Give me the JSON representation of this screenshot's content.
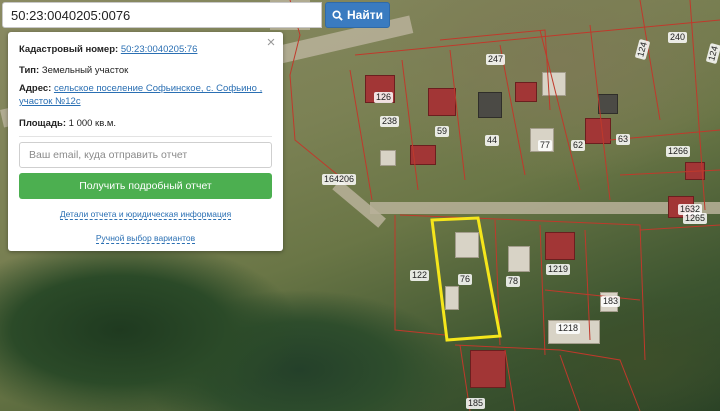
{
  "search": {
    "value": "50:23:0040205:0076",
    "button_label": "Найти"
  },
  "card": {
    "cadastral_label": "Кадастровый номер:",
    "cadastral_value": "50:23:0040205:76",
    "type_label": "Тип:",
    "type_value": "Земельный участок",
    "address_label": "Адрес:",
    "address_line1": "сельское поселение Софьинское, с. Софьино ,",
    "address_line2": "участок №12с",
    "area_label": "Площадь:",
    "area_value": "1 000 кв.м.",
    "email_placeholder": "Ваш email, куда отправить отчет",
    "report_button": "Получить подробный отчет",
    "details_link": "Детали отчета и юридическая информация",
    "manual_link": "Ручной выбор вариантов"
  },
  "map": {
    "parcel_labels": [
      "247",
      "240",
      "124",
      "124",
      "126",
      "238",
      "59",
      "44",
      "77",
      "62",
      "63",
      "1266",
      "164206",
      "1632",
      "1265",
      "122",
      "76",
      "78",
      "1219",
      "183",
      "1218",
      "185"
    ],
    "highlight_color": "#f5e61b",
    "boundary_color": "#c0392b"
  }
}
